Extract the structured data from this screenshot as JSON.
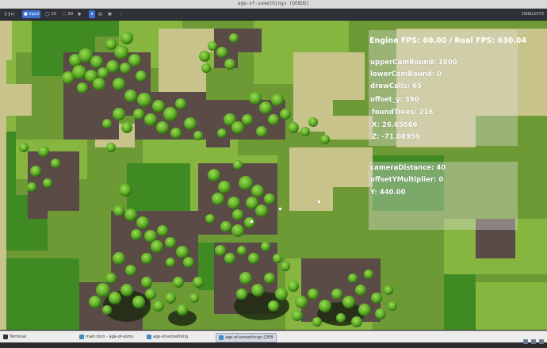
{
  "window": {
    "title": "age-of-somethings (DEBUG)",
    "resolution": "1908x1073"
  },
  "toolbar": {
    "pause_icon": "pause-icon",
    "input_label": "Input",
    "mode_2d_label": "2D",
    "mode_3d_label": "3D"
  },
  "hud": {
    "fps": "Engine FPS: 60.00 / Real FPS: 630.04",
    "upper_cam_bound": "upperCamBound: 1000",
    "lower_cam_bound": "lowerCamBound: 0",
    "draw_calls": "drawCalls: 65",
    "offset_y": "offset_y: 390",
    "found_trees": "foundTrees: 216",
    "x": "X: 26.65666",
    "z": "Z: -71.08959",
    "camera_distance": "cameraDistance: 40",
    "offset_y_multiplier": "offsetYMultiplier: 0",
    "y": "Y: 440.00"
  },
  "taskbar": {
    "terminal": "Terminal",
    "editor": "main.tscn - age-of-soms",
    "project": "age-of-something",
    "game": "age-of-somethings (DEB"
  },
  "colors": {
    "grass_dark": "#3f8a22",
    "grass_mid": "#5e9e2e",
    "grass_light": "#7fb53c",
    "dirt": "#5a4a45",
    "sand": "#c9c48c",
    "tree": "#6ab62c"
  }
}
